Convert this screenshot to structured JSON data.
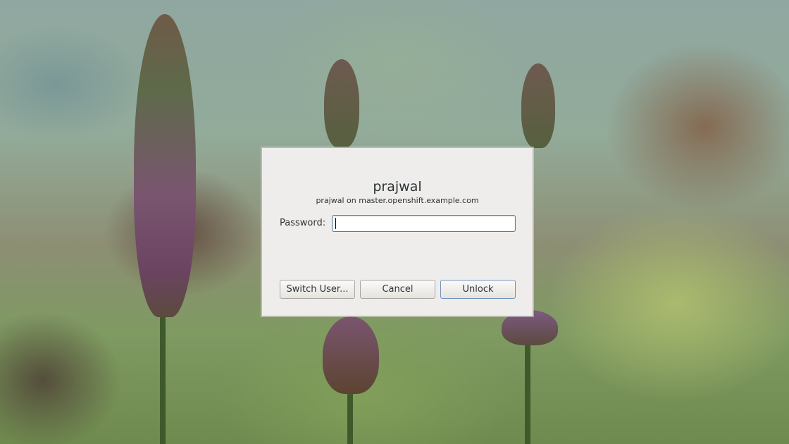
{
  "dialog": {
    "user_name": "prajwal",
    "host_line": "prajwal on master.openshift.example.com",
    "password_label": "Password:",
    "password_value": "",
    "buttons": {
      "switch_user": "Switch User...",
      "cancel": "Cancel",
      "unlock": "Unlock"
    }
  },
  "colors": {
    "dialog_bg": "#efedeb",
    "input_focus_border": "#4f7fae",
    "text": "#2e3436"
  }
}
